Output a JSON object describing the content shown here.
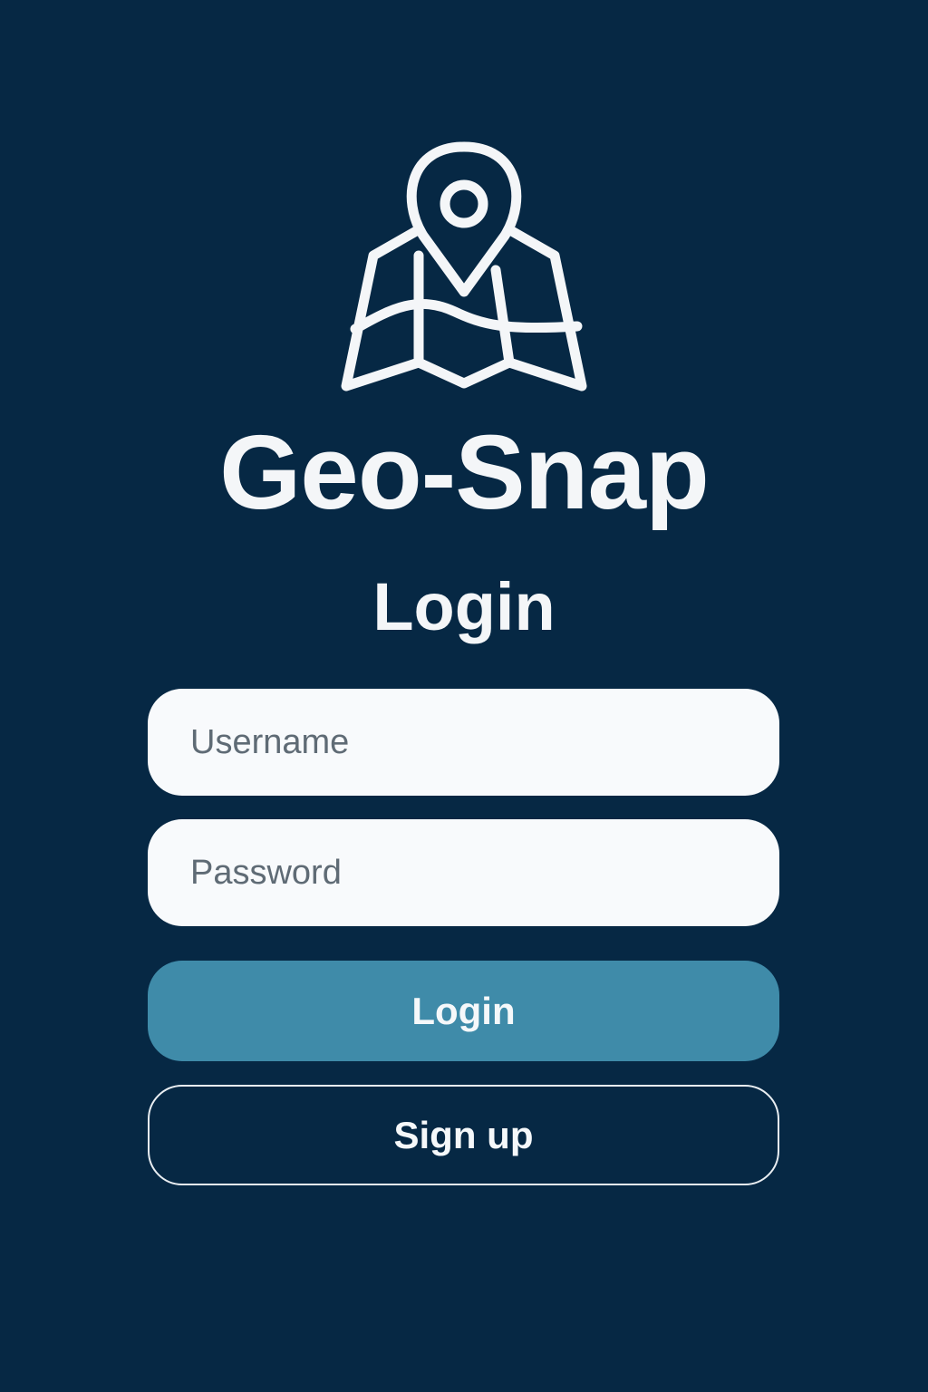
{
  "app": {
    "name": "Geo-Snap",
    "logo_icon": "map-pin-icon"
  },
  "login": {
    "heading": "Login",
    "username_placeholder": "Username",
    "password_placeholder": "Password",
    "login_button": "Login",
    "signup_button": "Sign up"
  },
  "colors": {
    "background": "#062844",
    "primary_button": "#3f8ba9",
    "text": "#f4f6f8",
    "field_background": "#f8fafc",
    "placeholder": "#5f6b75"
  }
}
